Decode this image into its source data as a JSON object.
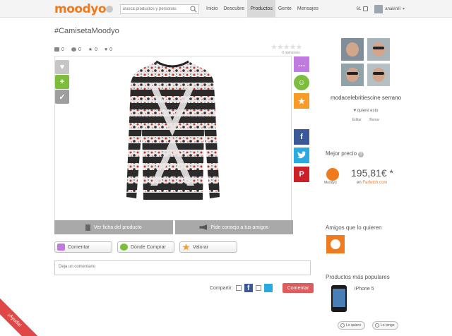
{
  "header": {
    "logo": "moodyo",
    "search_placeholder": "Busca productos y personas",
    "nav": [
      "Inicio",
      "Descubre",
      "Productos",
      "Gente",
      "Mensajes"
    ],
    "active_nav": "Productos",
    "notif_count": "61",
    "username": "anakinlll"
  },
  "page": {
    "title": "#CamisetaMoodyo",
    "stats": {
      "comments": "0",
      "shops": "0",
      "stars": "0",
      "likes": "0"
    },
    "rating_stars": "★★★★★",
    "opinions": "0 opiniones"
  },
  "product": {
    "ver_ficha": "Ver ficha del producto",
    "pide_consejo": "Pide consejo a tus amigos"
  },
  "actions": {
    "comentar": "Comentar",
    "donde_comprar": "Dónde Comprar",
    "valorar": "Valorar"
  },
  "comment": {
    "placeholder": "Deja un comentario",
    "share_label": "Compartir:",
    "submit": "Comentar"
  },
  "sidebar": {
    "user_name": "modacelebritiescine serrano",
    "quiere": "♥ quiere esto",
    "edit": "Editar",
    "delete": "Borrar",
    "mejor_precio_title": "Mejor precio",
    "price": "195,81€ *",
    "price_store_prefix": "en",
    "price_store": "Farfetch.com",
    "moodyo_label": "Moodyo",
    "amigos_title": "Amigos que lo quieren",
    "populares_title": "Productos más populares",
    "popular_item": "iPhone 5",
    "lo_quiero": "Lo quiero",
    "lo_tengo": "Lo tengo"
  },
  "help_tab": "¡Ayuda!",
  "colors": {
    "brand_orange": "#f07a1e",
    "comment_purple": "#c17be0",
    "shop_green": "#7cbd3c",
    "star_orange": "#f59b26",
    "facebook": "#3b5998",
    "twitter": "#2ba9e1",
    "pinterest": "#cb2027",
    "submit_red": "#e05b5b"
  }
}
